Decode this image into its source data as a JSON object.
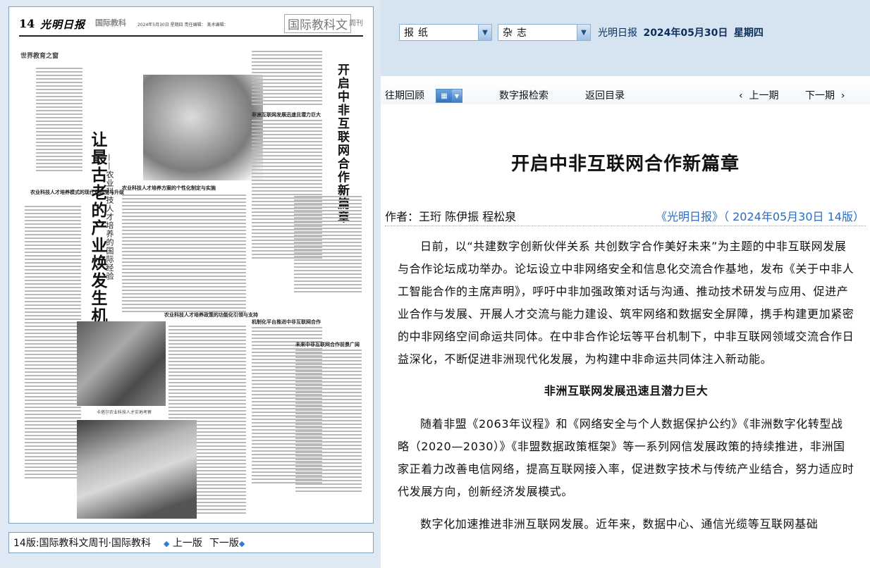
{
  "newspaper": {
    "page_num": "14",
    "masthead": "光明日报",
    "section": "国际教科",
    "date_line": "2024年5月30日  星期四    责任编辑：   美术编辑：",
    "column_title": "国际教科文",
    "column_sub": "周刊",
    "sub_section": "世界教育之窗",
    "left_headline": "让最古老的产业焕发生机",
    "left_subheadline": "——农业科技人才培养的国际经验",
    "right_headline": "开启中非互联网合作新篇章",
    "subheads": [
      "农业科技人才培养模式的现代化转型与升级",
      "农业科技人才培养方案的个性化制定与实施",
      "农业科技人才培养政策的功能化引领与支持",
      "非洲互联网发展迅速且潜力巨大",
      "机制化平台推进中非互联网合作",
      "未来中非互联网合作前景广阔"
    ],
    "caption": "卡塔尔农业科技人才实地考察"
  },
  "pager": {
    "label": "14版:国际教科文周刊·国际教科",
    "prev": "上一版",
    "next": "下一版"
  },
  "selectors": {
    "newspaper_select": "报纸",
    "magazine_select": "杂志"
  },
  "header": {
    "paper_name": "光明日报",
    "date": "2024年05月30日",
    "weekday": "星期四"
  },
  "nav": {
    "past_review": "往期回顾",
    "digital_search": "数字报检索",
    "back_to_index": "返回目录",
    "prev_issue": "上一期",
    "next_issue": "下一期"
  },
  "article": {
    "title": "开启中非互联网合作新篇章",
    "authors": "作者：王珩 陈伊振 程松泉",
    "source": "《光明日报》（ 2024年05月30日   14版）",
    "paragraphs": [
      "日前，以“共建数字创新伙伴关系  共创数字合作美好未来”为主题的中非互联网发展与合作论坛成功举办。论坛设立中非网络安全和信息化交流合作基地，发布《关于中非人工智能合作的主席声明》，呼吁中非加强政策对话与沟通、推动技术研发与应用、促进产业合作与发展、开展人才交流与能力建设、筑牢网络和数据安全屏障，携手构建更加紧密的中非网络空间命运共同体。在中非合作论坛等平台机制下，中非互联网领域交流合作日益深化，不断促进非洲现代化发展，为构建中非命运共同体注入新动能。"
    ],
    "section_heading": "非洲互联网发展迅速且潜力巨大",
    "paragraph2": "随着非盟《2063年议程》和《网络安全与个人数据保护公约》《非洲数字化转型战略（2020—2030）》《非盟数据政策框架》等一系列网信发展政策的持续推进，非洲国家正着力改善电信网络，提高互联网接入率，促进数字技术与传统产业结合，努力适应时代发展方向，创新经济发展模式。",
    "paragraph3": "数字化加速推进非洲互联网发展。近年来，数据中心、通信光缆等互联网基础"
  },
  "colors": {
    "panel_bg": "#dfe9f3",
    "header_bg": "#d6e4f2",
    "link_blue": "#2a6cc0",
    "date_navy": "#0b2e5c"
  }
}
